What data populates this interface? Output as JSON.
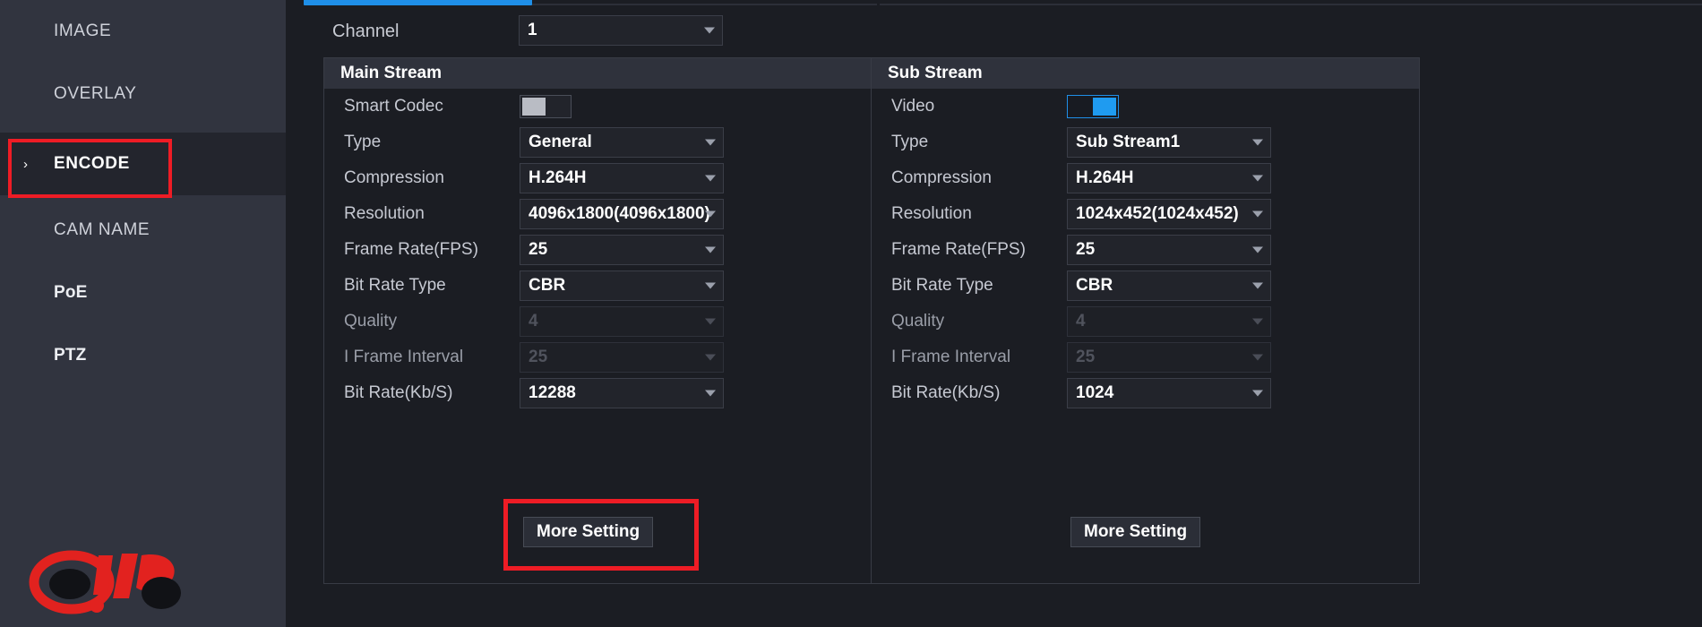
{
  "sidebar": {
    "items": [
      {
        "label": "IMAGE",
        "active": false,
        "chevron": false,
        "bold": false
      },
      {
        "label": "OVERLAY",
        "active": false,
        "chevron": false,
        "bold": false
      },
      {
        "label": "ENCODE",
        "active": true,
        "chevron": true,
        "bold": false
      },
      {
        "label": "CAM NAME",
        "active": false,
        "chevron": false,
        "bold": false
      },
      {
        "label": "PoE",
        "active": false,
        "chevron": false,
        "bold": true
      },
      {
        "label": "PTZ",
        "active": false,
        "chevron": false,
        "bold": true
      }
    ],
    "chevron_glyph": "›",
    "highlight_color": "#ee1c25",
    "logo_alt": "aip-logo"
  },
  "toolbar": {
    "channel_label": "Channel",
    "channel_value": "1",
    "active_tab_color": "#1f8fe8"
  },
  "main_stream": {
    "title": "Main Stream",
    "rows": [
      {
        "label": "Smart Codec",
        "type": "toggle",
        "value": "Off",
        "on": false,
        "disabled": false
      },
      {
        "label": "Type",
        "type": "select",
        "value": "General",
        "disabled": false
      },
      {
        "label": "Compression",
        "type": "select",
        "value": "H.264H",
        "disabled": false
      },
      {
        "label": "Resolution",
        "type": "select",
        "value": "4096x1800(4096x1800)",
        "disabled": false
      },
      {
        "label": "Frame Rate(FPS)",
        "type": "select",
        "value": "25",
        "disabled": false
      },
      {
        "label": "Bit Rate Type",
        "type": "select",
        "value": "CBR",
        "disabled": false
      },
      {
        "label": "Quality",
        "type": "select",
        "value": "4",
        "disabled": true
      },
      {
        "label": "I Frame Interval",
        "type": "select",
        "value": "25",
        "disabled": true
      },
      {
        "label": "Bit Rate(Kb/S)",
        "type": "select",
        "value": "12288",
        "disabled": false
      }
    ],
    "more_button": "More Setting",
    "more_highlighted": true
  },
  "sub_stream": {
    "title": "Sub Stream",
    "rows": [
      {
        "label": "Video",
        "type": "toggle",
        "value": "On",
        "on": true,
        "disabled": false
      },
      {
        "label": "Type",
        "type": "select",
        "value": "Sub Stream1",
        "disabled": false
      },
      {
        "label": "Compression",
        "type": "select",
        "value": "H.264H",
        "disabled": false
      },
      {
        "label": "Resolution",
        "type": "select",
        "value": "1024x452(1024x452)",
        "disabled": false
      },
      {
        "label": "Frame Rate(FPS)",
        "type": "select",
        "value": "25",
        "disabled": false
      },
      {
        "label": "Bit Rate Type",
        "type": "select",
        "value": "CBR",
        "disabled": false
      },
      {
        "label": "Quality",
        "type": "select",
        "value": "4",
        "disabled": true
      },
      {
        "label": "I Frame Interval",
        "type": "select",
        "value": "25",
        "disabled": true
      },
      {
        "label": "Bit Rate(Kb/S)",
        "type": "select",
        "value": "1024",
        "disabled": false
      }
    ],
    "more_button": "More Setting",
    "more_highlighted": false
  }
}
